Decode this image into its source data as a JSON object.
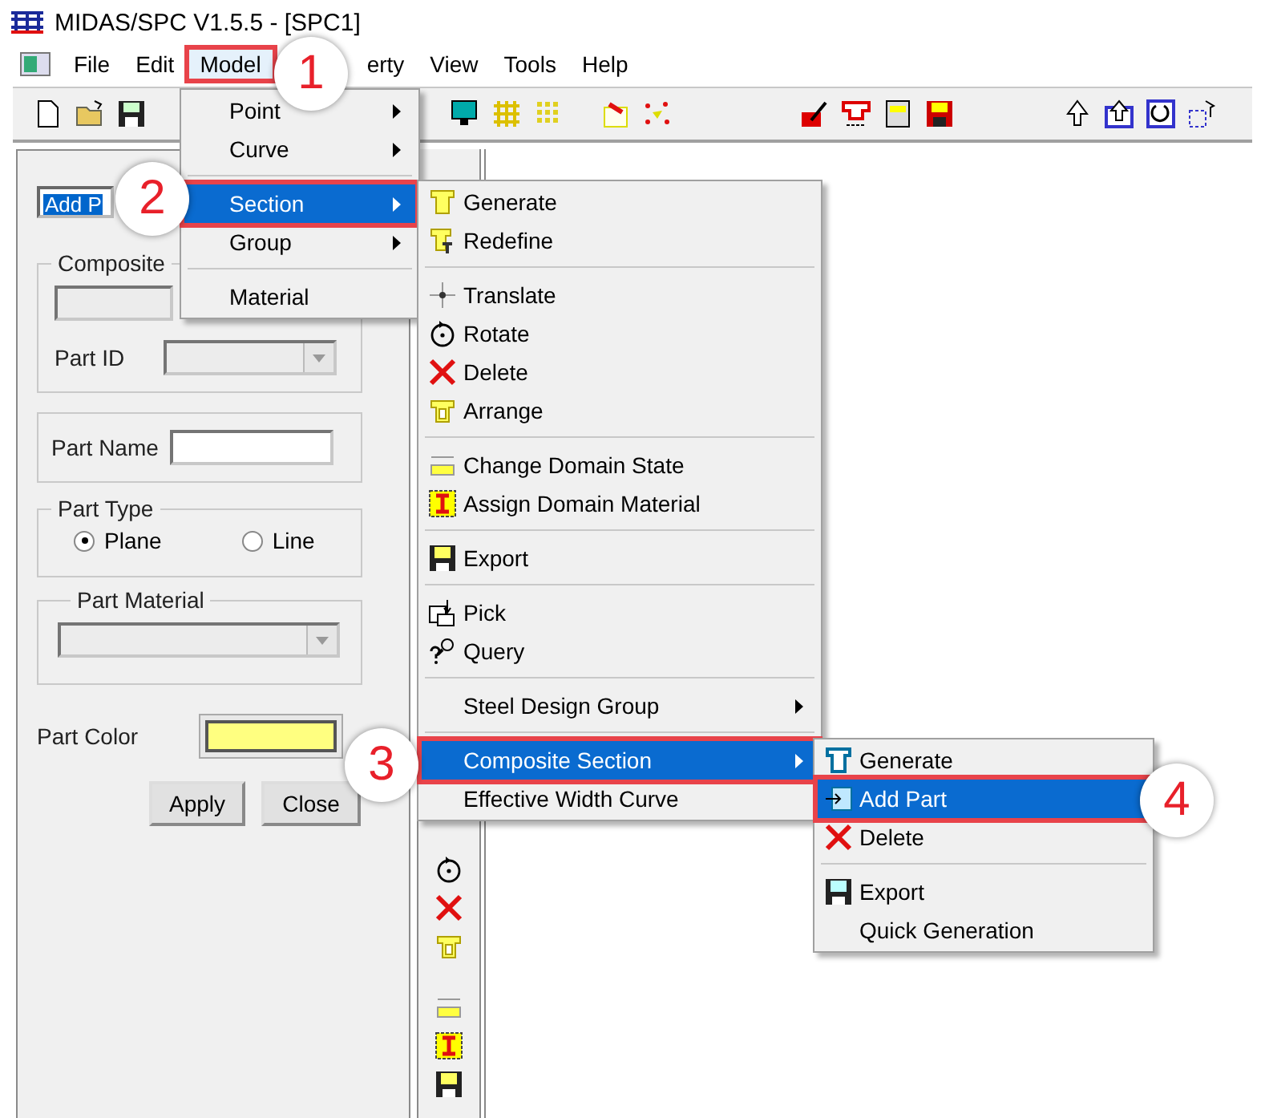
{
  "window": {
    "title": "MIDAS/SPC V1.5.5 - [SPC1]"
  },
  "menu_bar": [
    {
      "label": "File",
      "selected": false
    },
    {
      "label": "Edit",
      "selected": false
    },
    {
      "label": "Model",
      "selected": true
    },
    {
      "label": "erty",
      "selected": false
    },
    {
      "label": "View",
      "selected": false
    },
    {
      "label": "Tools",
      "selected": false
    },
    {
      "label": "Help",
      "selected": false
    }
  ],
  "left_panel": {
    "mode_field": "Add P",
    "composite_group_label": "Composite",
    "part_id_label": "Part ID",
    "part_name_label": "Part Name",
    "part_type": {
      "label": "Part Type",
      "options": [
        {
          "label": "Plane",
          "selected": true
        },
        {
          "label": "Line",
          "selected": false
        }
      ]
    },
    "part_material_label": "Part Material",
    "part_color_label": "Part Color",
    "buttons": [
      "Apply",
      "Close"
    ]
  },
  "model_menu": {
    "groups": [
      [
        {
          "label": "Point",
          "submenu": true,
          "selected": false
        },
        {
          "label": "Curve",
          "submenu": true,
          "selected": false
        }
      ],
      [
        {
          "label": "Section",
          "submenu": true,
          "selected": true
        },
        {
          "label": "Group",
          "submenu": true,
          "selected": false
        }
      ],
      [
        {
          "label": "Material",
          "submenu": false,
          "selected": false
        }
      ]
    ]
  },
  "section_menu": {
    "groups": [
      [
        {
          "label": "Generate",
          "submenu": false,
          "selected": false
        },
        {
          "label": "Redefine",
          "submenu": false,
          "selected": false
        }
      ],
      [
        {
          "label": "Translate",
          "submenu": false,
          "selected": false
        },
        {
          "label": "Rotate",
          "submenu": false,
          "selected": false
        },
        {
          "label": "Delete",
          "submenu": false,
          "selected": false
        },
        {
          "label": "Arrange",
          "submenu": false,
          "selected": false
        }
      ],
      [
        {
          "label": "Change Domain State",
          "submenu": false,
          "selected": false
        },
        {
          "label": "Assign Domain Material",
          "submenu": false,
          "selected": false
        }
      ],
      [
        {
          "label": "Export",
          "submenu": false,
          "selected": false
        }
      ],
      [
        {
          "label": "Pick",
          "submenu": false,
          "selected": false
        },
        {
          "label": "Query",
          "submenu": false,
          "selected": false
        }
      ],
      [
        {
          "label": "Steel Design Group",
          "submenu": true,
          "selected": false
        }
      ],
      [
        {
          "label": "Composite Section",
          "submenu": true,
          "selected": true
        },
        {
          "label": "Effective Width Curve",
          "submenu": false,
          "selected": false
        }
      ]
    ]
  },
  "composite_menu": {
    "groups": [
      [
        {
          "label": "Generate",
          "submenu": false,
          "selected": false
        },
        {
          "label": "Add Part",
          "submenu": false,
          "selected": true
        },
        {
          "label": "Delete",
          "submenu": false,
          "selected": false
        }
      ],
      [
        {
          "label": "Export",
          "submenu": false,
          "selected": false
        },
        {
          "label": "Quick Generation",
          "submenu": false,
          "selected": false
        }
      ]
    ]
  },
  "callouts": [
    {
      "label": "1"
    },
    {
      "label": "2"
    },
    {
      "label": "3"
    },
    {
      "label": "4"
    }
  ]
}
